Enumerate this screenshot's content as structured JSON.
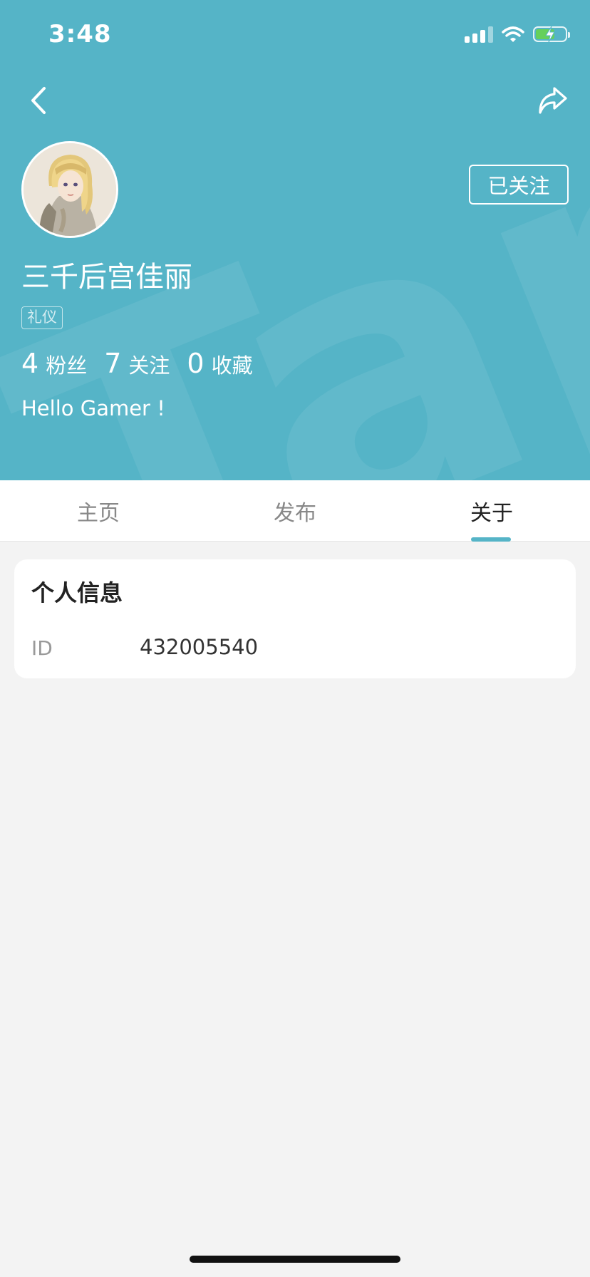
{
  "status_bar": {
    "time": "3:48"
  },
  "header": {
    "watermark": "apTap",
    "follow_button_label": "已关注",
    "username": "三千后宫佳丽",
    "tag": "礼仪",
    "stats": [
      {
        "count": "4",
        "label": "粉丝"
      },
      {
        "count": "7",
        "label": "关注"
      },
      {
        "count": "0",
        "label": "收藏"
      }
    ],
    "bio": "Hello Gamer !"
  },
  "tabs": [
    {
      "label": "主页"
    },
    {
      "label": "发布"
    },
    {
      "label": "关于"
    }
  ],
  "active_tab": "关于",
  "info_card": {
    "title": "个人信息",
    "id_label": "ID",
    "id_value": "432005540"
  },
  "colors": {
    "header_bg": "#55b4c7",
    "accent": "#55b4c7",
    "page_bg": "#f3f3f3"
  },
  "icons": [
    "back-arrow-icon",
    "share-icon",
    "signal-icon",
    "wifi-icon",
    "battery-icon"
  ]
}
